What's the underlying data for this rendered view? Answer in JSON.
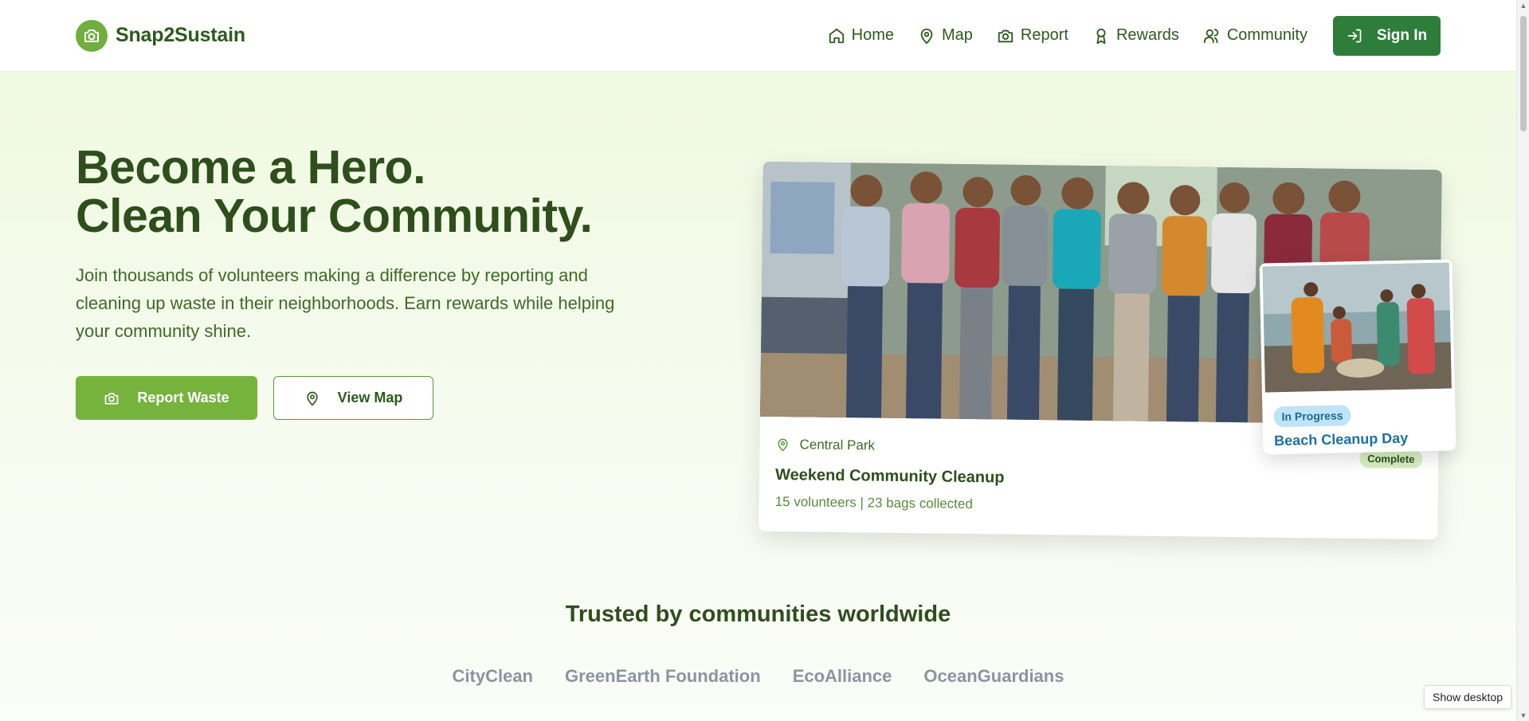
{
  "brand": {
    "name": "Snap2Sustain",
    "icon": "camera-icon"
  },
  "nav": [
    {
      "label": "Home",
      "icon": "home-icon"
    },
    {
      "label": "Map",
      "icon": "map-pin-icon"
    },
    {
      "label": "Report",
      "icon": "camera-icon"
    },
    {
      "label": "Rewards",
      "icon": "award-icon"
    },
    {
      "label": "Community",
      "icon": "users-icon"
    }
  ],
  "signin": {
    "label": "Sign In",
    "icon": "log-in-icon"
  },
  "hero": {
    "title_line1": "Become a Hero.",
    "title_line2": "Clean Your Community.",
    "subtitle": "Join thousands of volunteers making a difference by reporting and cleaning up waste in their neighborhoods. Earn rewards while helping your community shine.",
    "primary_button": "Report Waste",
    "secondary_button": "View Map"
  },
  "main_card": {
    "location": "Central Park",
    "title": "Weekend Community Cleanup",
    "stats": "15 volunteers | 23 bags collected",
    "status": "Complete"
  },
  "overlay_card": {
    "status": "In Progress",
    "title": "Beach Cleanup Day"
  },
  "trusted": {
    "title": "Trusted by communities worldwide",
    "logos": [
      "CityClean",
      "GreenEarth Foundation",
      "EcoAlliance",
      "OceanGuardians"
    ]
  },
  "system": {
    "show_desktop": "Show desktop"
  },
  "colors": {
    "brand_green": "#6fae3f",
    "dark_green": "#2e7d3b",
    "title_green": "#2e4e1c",
    "accent_blue": "#1d6fa5"
  }
}
